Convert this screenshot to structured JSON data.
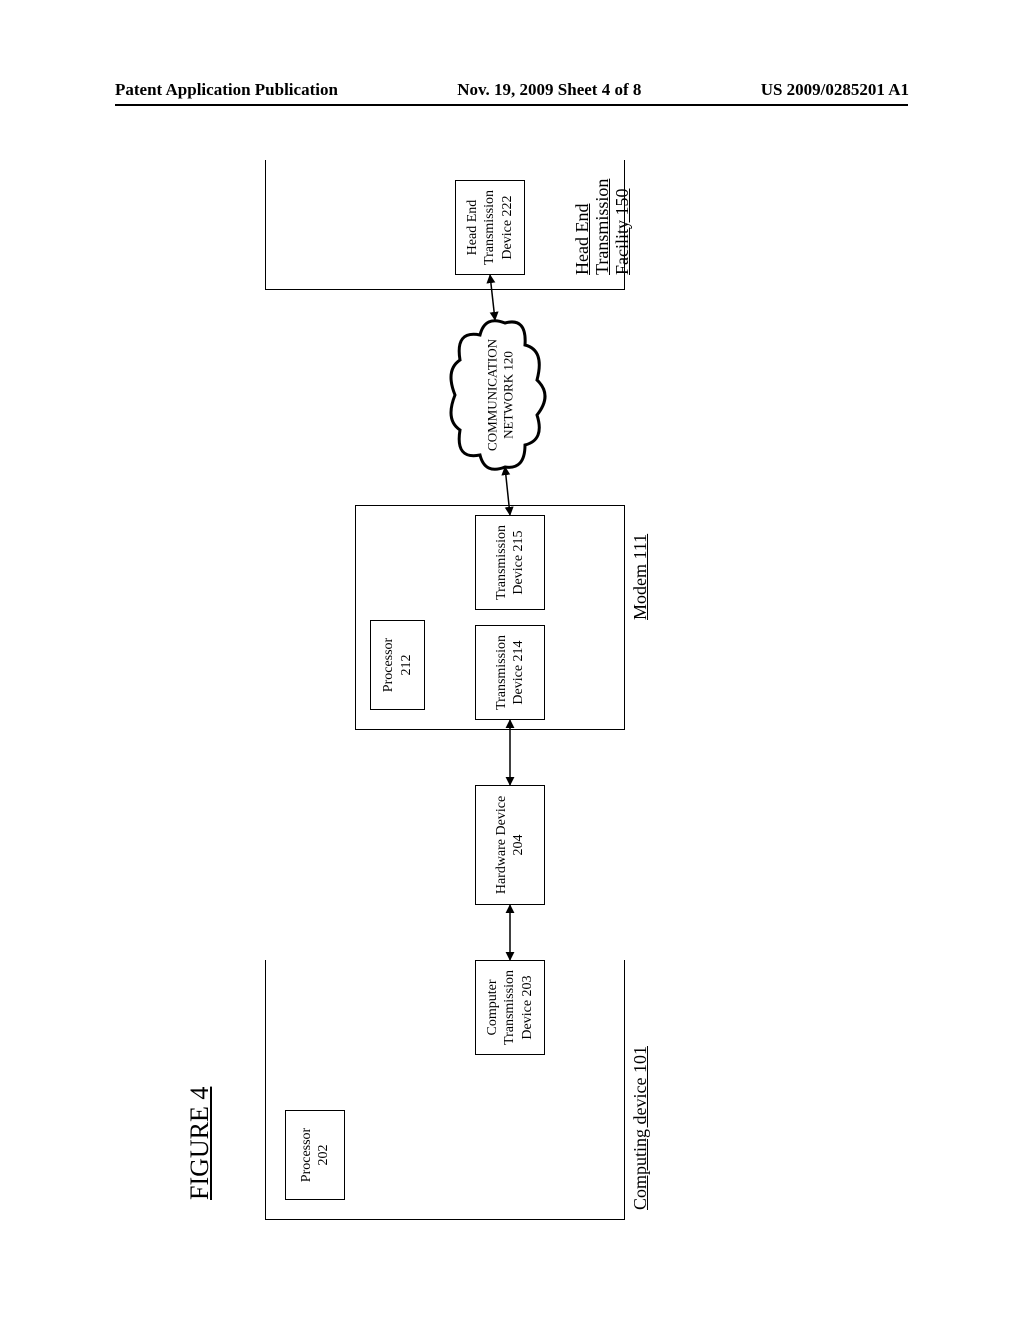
{
  "header": {
    "left": "Patent Application Publication",
    "center": "Nov. 19, 2009  Sheet 4 of 8",
    "right": "US 2009/0285201 A1"
  },
  "figure": {
    "title": "FIGURE 4"
  },
  "blocks": {
    "processor202": "Processor\n202",
    "computerTrans203": "Computer\nTransmission\nDevice 203",
    "computing101": "Computing device 101",
    "hardware204": "Hardware Device\n204",
    "processor212": "Processor\n212",
    "trans214": "Transmission\nDevice 214",
    "trans215": "Transmission\nDevice 215",
    "modem111": "Modem 111",
    "network120": "COMMUNICATION\nNETWORK 120",
    "headEnd222": "Head End\nTransmission\nDevice 222",
    "facility150": "Head End\nTransmission\nFacility 150"
  }
}
